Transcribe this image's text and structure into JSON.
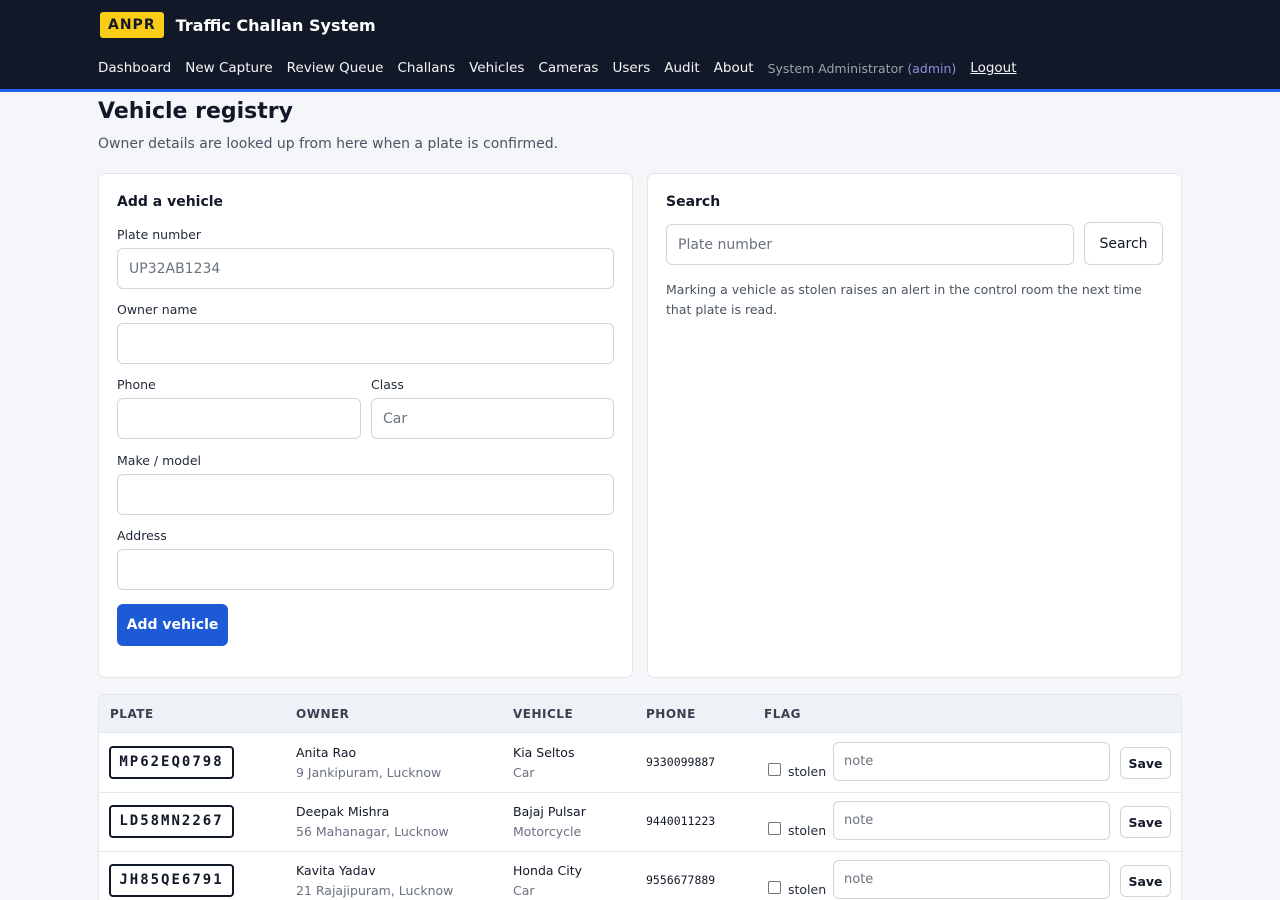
{
  "header": {
    "badge": "ANPR",
    "app_title": "Traffic Challan System",
    "nav": [
      "Dashboard",
      "New Capture",
      "Review Queue",
      "Challans",
      "Vehicles",
      "Cameras",
      "Users",
      "Audit",
      "About"
    ],
    "user_name": "System Administrator",
    "user_role": "(admin)",
    "logout": "Logout"
  },
  "page": {
    "title": "Vehicle registry",
    "subtitle": "Owner details are looked up from here when a plate is confirmed."
  },
  "add_form": {
    "heading": "Add a vehicle",
    "plate_label": "Plate number",
    "plate_placeholder": "UP32AB1234",
    "owner_label": "Owner name",
    "phone_label": "Phone",
    "class_label": "Class",
    "class_placeholder": "Car",
    "make_label": "Make / model",
    "address_label": "Address",
    "submit": "Add vehicle"
  },
  "search": {
    "heading": "Search",
    "placeholder": "Plate number",
    "button": "Search",
    "hint": "Marking a vehicle as stolen raises an alert in the control room the next time that plate is read."
  },
  "table": {
    "columns": [
      "PLATE",
      "OWNER",
      "VEHICLE",
      "PHONE",
      "FLAG"
    ],
    "stolen_label": "stolen",
    "note_placeholder": "note",
    "save_label": "Save",
    "rows": [
      {
        "plate": "MP62EQ0798",
        "owner": "Anita Rao",
        "address": "9 Jankipuram, Lucknow",
        "model": "Kia Seltos",
        "class": "Car",
        "phone": "9330099887"
      },
      {
        "plate": "LD58MN2267",
        "owner": "Deepak Mishra",
        "address": "56 Mahanagar, Lucknow",
        "model": "Bajaj Pulsar",
        "class": "Motorcycle",
        "phone": "9440011223"
      },
      {
        "plate": "JH85QE6791",
        "owner": "Kavita Yadav",
        "address": "21 Rajajipuram, Lucknow",
        "model": "Honda City",
        "class": "Car",
        "phone": "9556677889"
      }
    ]
  }
}
